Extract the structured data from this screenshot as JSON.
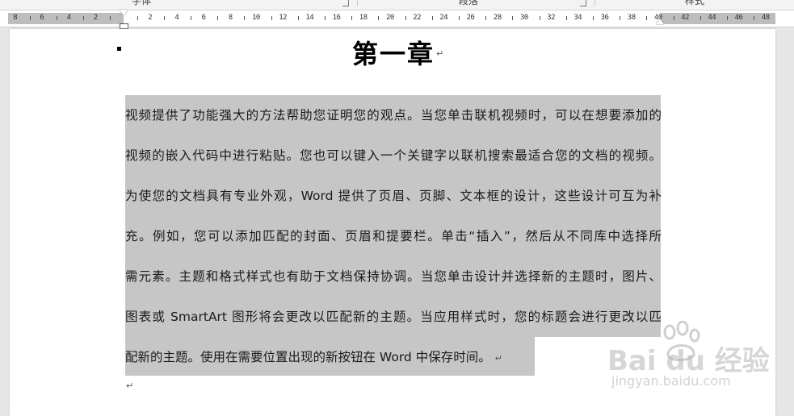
{
  "ribbon": {
    "groups": [
      "字体",
      "段落",
      "样式"
    ]
  },
  "ruler": {
    "left_numbers": [
      "8",
      "6",
      "4",
      "2"
    ],
    "numbers": [
      "2",
      "4",
      "6",
      "8",
      "10",
      "12",
      "14",
      "16",
      "18",
      "20",
      "22",
      "24",
      "26",
      "28",
      "30",
      "32",
      "34",
      "36",
      "38",
      "40",
      "42",
      "44",
      "46",
      "48"
    ]
  },
  "document": {
    "heading": "第一章",
    "paragraph_mark": "↵",
    "lines": [
      "视频提供了功能强大的方法帮助您证明您的观点。当您单击联机视频时，可以在想要添加的",
      "视频的嵌入代码中进行粘贴。您也可以键入一个关键字以联机搜索最适合您的文档的视频。",
      "为使您的文档具有专业外观，Word 提供了页眉、页脚、文本框的设计，这些设计可互为补",
      "充。例如，您可以添加匹配的封面、页眉和提要栏。单击“插入”，然后从不同库中选择所",
      "需元素。主题和格式样式也有助于文档保持协调。当您单击设计并选择新的主题时，图片、",
      "图表或 SmartArt 图形将会更改以匹配新的主题。当应用样式时，您的标题会进行更改以匹",
      "配新的主题。使用在需要位置出现的新按钮在 Word 中保存时间。"
    ]
  },
  "watermark": {
    "logo": "Bai du 经验",
    "url": "jingyan.baidu.com"
  }
}
